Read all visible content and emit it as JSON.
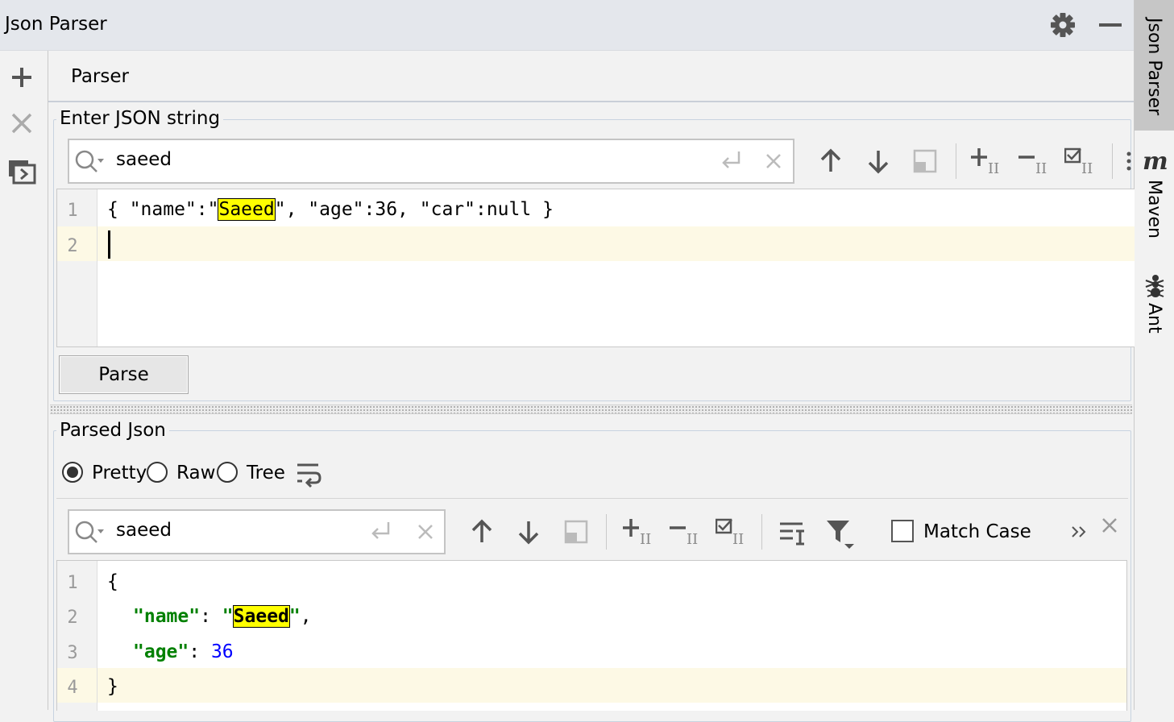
{
  "window": {
    "title": "Json Parser"
  },
  "tabs": [
    {
      "label": "Parser"
    }
  ],
  "input_section": {
    "legend": "Enter JSON string",
    "search": {
      "value": "saeed"
    },
    "editor": {
      "lines": [
        {
          "number": "1",
          "prefix": "{ \"name\":\"",
          "match": "Saeed",
          "suffix": "\", \"age\":36, \"car\":null }"
        },
        {
          "number": "2"
        }
      ]
    },
    "parse_button": "Parse"
  },
  "output_section": {
    "legend": "Parsed Json",
    "view_modes": [
      {
        "label": "Pretty",
        "selected": true
      },
      {
        "label": "Raw",
        "selected": false
      },
      {
        "label": "Tree",
        "selected": false
      }
    ],
    "search": {
      "value": "saeed"
    },
    "match_case": {
      "label": "Match Case",
      "checked": false
    },
    "editor": {
      "lines": [
        {
          "number": "1",
          "text": "{"
        },
        {
          "number": "2",
          "key": "\"name\"",
          "sep": ": ",
          "q1": "\"",
          "match": "Saeed",
          "q2": "\"",
          "tail": ","
        },
        {
          "number": "3",
          "key": "\"age\"",
          "sep": ": ",
          "value": "36"
        },
        {
          "number": "4",
          "text": "}"
        }
      ]
    }
  },
  "side_stripe": {
    "items": [
      "Json Parser",
      "Maven",
      "Ant"
    ]
  },
  "colors": {
    "match_highlight": "#ffff00",
    "json_key": "#008000",
    "json_number": "#0000ff",
    "current_line": "#fdf9e5"
  },
  "icons": [
    "settings-icon",
    "minimize-icon",
    "add-icon",
    "close-icon",
    "restore-icon",
    "search-icon",
    "newline-icon",
    "clear-icon",
    "arrow-up-icon",
    "arrow-down-icon",
    "select-all-occurrences-icon",
    "add-selection-icon",
    "remove-selection-icon",
    "toggle-selection-icon",
    "soft-wrap-icon",
    "filter-icon",
    "more-icon",
    "maven-icon",
    "ant-icon"
  ]
}
